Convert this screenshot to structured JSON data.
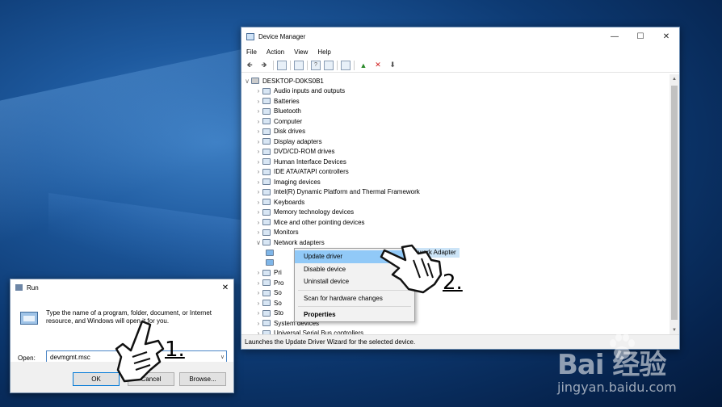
{
  "device_manager": {
    "title": "Device Manager",
    "menu": [
      "File",
      "Action",
      "View",
      "Help"
    ],
    "root": "DESKTOP-D0KS0B1",
    "categories": [
      {
        "label": "Audio inputs and outputs",
        "expanded": false
      },
      {
        "label": "Batteries",
        "expanded": false
      },
      {
        "label": "Bluetooth",
        "expanded": false
      },
      {
        "label": "Computer",
        "expanded": false
      },
      {
        "label": "Disk drives",
        "expanded": false
      },
      {
        "label": "Display adapters",
        "expanded": false
      },
      {
        "label": "DVD/CD-ROM drives",
        "expanded": false
      },
      {
        "label": "Human Interface Devices",
        "expanded": false
      },
      {
        "label": "IDE ATA/ATAPI controllers",
        "expanded": false
      },
      {
        "label": "Imaging devices",
        "expanded": false
      },
      {
        "label": "Intel(R) Dynamic Platform and Thermal Framework",
        "expanded": false
      },
      {
        "label": "Keyboards",
        "expanded": false
      },
      {
        "label": "Memory technology devices",
        "expanded": false
      },
      {
        "label": "Mice and other pointing devices",
        "expanded": false
      },
      {
        "label": "Monitors",
        "expanded": false
      },
      {
        "label": "Network adapters",
        "expanded": true
      }
    ],
    "network_child_visible": "work Adapter",
    "partial_rows": [
      "Pri",
      "Pro",
      "So",
      "So",
      "Sto"
    ],
    "after_rows": [
      "System devices",
      "Universal Serial Bus controllers"
    ],
    "status": "Launches the Update Driver Wizard for the selected device."
  },
  "context_menu": {
    "items": [
      "Update driver",
      "Disable device",
      "Uninstall device",
      "Scan for hardware changes",
      "Properties"
    ],
    "highlighted": "Update driver",
    "bold": "Properties"
  },
  "run_dialog": {
    "title": "Run",
    "description": "Type the name of a program, folder, document, or Internet resource, and Windows will open it for you.",
    "open_label": "Open:",
    "input_value": "devmgmt.msc",
    "buttons": {
      "ok": "OK",
      "cancel": "Cancel",
      "browse": "Browse..."
    }
  },
  "steps": {
    "one": "1.",
    "two": "2."
  },
  "watermark": {
    "logo": "Bai  经验",
    "url": "jingyan.baidu.com"
  },
  "colors": {
    "accent": "#0078d7",
    "menu_highlight": "#91c9f7",
    "desktop": "#0d3a73"
  }
}
